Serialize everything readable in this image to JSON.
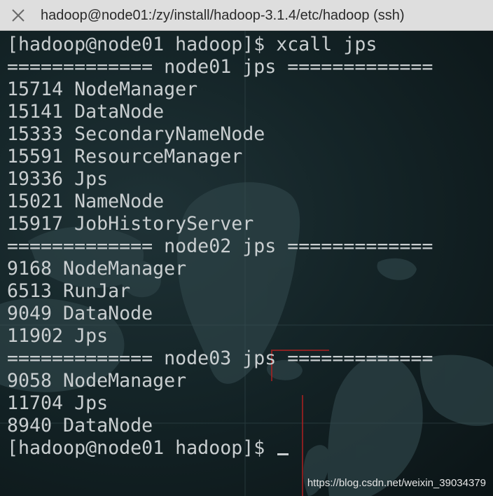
{
  "window": {
    "title": "hadoop@node01:/zy/install/hadoop-3.1.4/etc/hadoop (ssh)",
    "close_icon": "close-icon"
  },
  "terminal": {
    "lines": [
      "[hadoop@node01 hadoop]$ xcall jps",
      "============= node01 jps =============",
      "15714 NodeManager",
      "15141 DataNode",
      "15333 SecondaryNameNode",
      "15591 ResourceManager",
      "19336 Jps",
      "15021 NameNode",
      "15917 JobHistoryServer",
      "============= node02 jps =============",
      "9168 NodeManager",
      "6513 RunJar",
      "9049 DataNode",
      "11902 Jps",
      "============= node03 jps =============",
      "9058 NodeManager",
      "11704 Jps",
      "8940 DataNode"
    ],
    "prompt": "[hadoop@node01 hadoop]$ "
  },
  "watermark": "https://blog.csdn.net/weixin_39034379",
  "colors": {
    "titlebar_bg": "#dedede",
    "terminal_text": "#c9ced0",
    "terminal_bg": "#142427",
    "map_accent": "#b02020"
  }
}
